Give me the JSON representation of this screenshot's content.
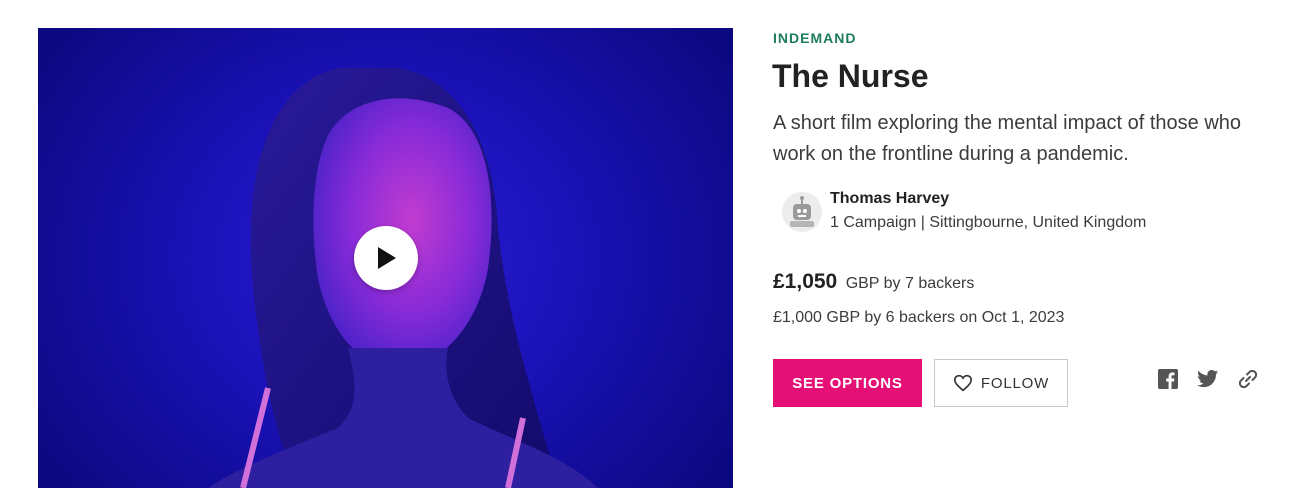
{
  "campaign": {
    "category": "INDEMAND",
    "title": "The Nurse",
    "tagline": "A short film exploring the mental impact of those who work on the frontline during a pandemic."
  },
  "owner": {
    "name": "Thomas Harvey",
    "meta": "1 Campaign | Sittingbourne, United Kingdom"
  },
  "funding": {
    "amount": "£1,050",
    "amount_suffix": "GBP by 7 backers",
    "goal_line": "£1,000 GBP by 6 backers on Oct 1, 2023"
  },
  "actions": {
    "see_options_label": "SEE OPTIONS",
    "follow_label": "FOLLOW"
  },
  "icons": {
    "play": "play-icon",
    "follow": "heart-icon",
    "share": [
      "facebook-icon",
      "twitter-icon",
      "link-icon"
    ]
  },
  "colors": {
    "accent": "#e51075",
    "category": "#1e7d5c",
    "share_icons": "#555555",
    "video_bg": "#1a12b8"
  }
}
